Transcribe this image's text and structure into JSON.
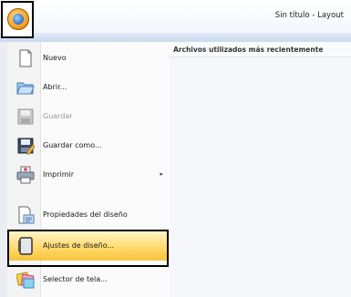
{
  "window": {
    "title": "Sin título - Layout"
  },
  "menu": {
    "items": [
      {
        "label": "Nuevo",
        "icon": "new-document-icon",
        "disabled": false
      },
      {
        "label": "Abrir...",
        "icon": "open-folder-icon",
        "disabled": false
      },
      {
        "label": "Guardar",
        "icon": "save-icon",
        "disabled": true
      },
      {
        "label": "Guardar como...",
        "icon": "save-as-icon",
        "disabled": false
      },
      {
        "label": "Imprimir",
        "icon": "printer-icon",
        "disabled": false,
        "submenu": true
      },
      {
        "label": "Propiedades del diseño",
        "icon": "design-properties-icon",
        "disabled": false
      },
      {
        "label": "Ajustes de diseño...",
        "icon": "design-settings-icon",
        "disabled": false,
        "highlighted": true
      },
      {
        "label": "Selector de tela...",
        "icon": "fabric-selector-icon",
        "disabled": false
      }
    ]
  },
  "recent": {
    "title": "Archivos utilizados más recientemente"
  },
  "colors": {
    "highlight": "#ffd866",
    "menu_bg": "#fbfbfb",
    "frame": "#000000"
  }
}
